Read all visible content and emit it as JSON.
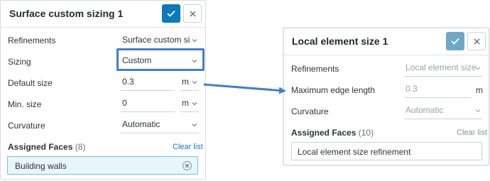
{
  "left_panel": {
    "title": "Surface custom sizing 1",
    "rows": {
      "refinements_label": "Refinements",
      "refinements_value": "Surface custom sizin",
      "sizing_label": "Sizing",
      "sizing_value": "Custom",
      "default_size_label": "Default size",
      "default_size_value": "0.3",
      "default_size_unit": "m",
      "min_size_label": "Min. size",
      "min_size_value": "0",
      "min_size_unit": "m",
      "curvature_label": "Curvature",
      "curvature_value": "Automatic"
    },
    "assigned_faces": {
      "label": "Assigned Faces",
      "count": "(8)",
      "clear": "Clear list"
    },
    "chip": "Building walls"
  },
  "right_panel": {
    "title": "Local element size 1",
    "rows": {
      "refinements_label": "Refinements",
      "refinements_value": "Local element size",
      "max_edge_label": "Maximum edge length",
      "max_edge_value": "0.3",
      "max_edge_unit": "m",
      "curvature_label": "Curvature",
      "curvature_value": "Automatic"
    },
    "assigned_faces": {
      "label": "Assigned Faces",
      "count": "(10)",
      "clear": "Clear list"
    },
    "face_entry": "Local element size refinement"
  },
  "colors": {
    "accent": "#0a7ab8",
    "accent_disabled": "#6fa8c6",
    "highlight_border": "#3f7fd0",
    "arrow": "#3f7fd0",
    "chip_bg": "#e8f6fb",
    "chip_border": "#6cc3d9"
  },
  "icons": {
    "confirm": "check-icon",
    "close": "close-icon",
    "dropdown": "chevron-down-icon",
    "remove": "remove-circle-icon"
  }
}
